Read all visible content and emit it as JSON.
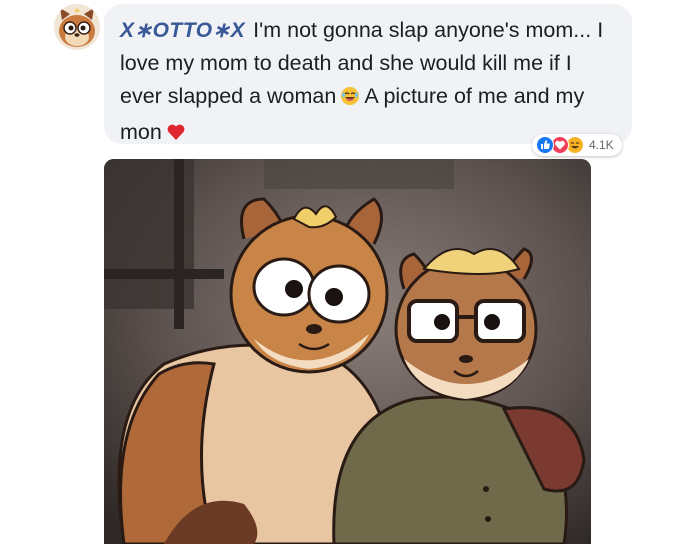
{
  "comment": {
    "author": "X∗OTTO∗X",
    "text_parts": [
      "I'm not gonna slap anyone's mom... I love my mom to death and she would kill me if I ever slapped a woman",
      "A picture of me and my mon"
    ],
    "emojis": [
      "laughing-emoji",
      "heart-emoji"
    ]
  },
  "reactions": {
    "count": "4.1K",
    "icons": [
      "like-icon",
      "love-icon",
      "haha-icon"
    ],
    "colors": {
      "like": "#1877f2",
      "love": "#f33e58",
      "haha": "#f7b125"
    }
  },
  "colors": {
    "bubble": "#f0f2f5",
    "author": "#385898",
    "text": "#1c1e21"
  }
}
